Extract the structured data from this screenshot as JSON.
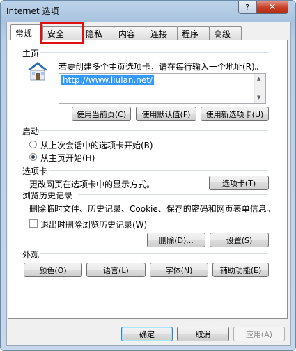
{
  "window": {
    "title": "Internet 选项",
    "help_glyph": "?",
    "close_glyph": "✕"
  },
  "tabs": [
    {
      "label": "常规"
    },
    {
      "label": "安全"
    },
    {
      "label": "隐私"
    },
    {
      "label": "内容"
    },
    {
      "label": "连接"
    },
    {
      "label": "程序"
    },
    {
      "label": "高级"
    }
  ],
  "homepage": {
    "group_label": "主页",
    "description": "若要创建多个主页选项卡，请在每行输入一个地址(R)。",
    "url": "http://www.liulan.net/",
    "use_current": "使用当前页(C)",
    "use_default": "使用默认值(F)",
    "use_new_tab": "使用新选项卡(U)"
  },
  "startup": {
    "group_label": "启动",
    "option_last_session": "从上次会话中的选项卡开始(B)",
    "option_homepage": "从主页开始(H)",
    "selected": "option_homepage"
  },
  "tabs_section": {
    "group_label": "选项卡",
    "description": "更改网页在选项卡中的显示方式。",
    "button": "选项卡(T)"
  },
  "history": {
    "group_label": "浏览历史记录",
    "description": "删除临时文件、历史记录、Cookie、保存的密码和网页表单信息。",
    "checkbox_label": "退出时删除浏览历史记录(W)",
    "checkbox_checked": false,
    "delete_button": "删除(D)...",
    "settings_button": "设置(S)"
  },
  "appearance": {
    "group_label": "外观",
    "colors": "颜色(O)",
    "languages": "语言(L)",
    "fonts": "字体(N)",
    "accessibility": "辅助功能(E)"
  },
  "footer": {
    "ok": "确定",
    "cancel": "取消",
    "apply": "应用(A)"
  },
  "colors": {
    "highlight_box": "#e01010",
    "selection": "#3399ff",
    "close_button": "#c8432b"
  }
}
